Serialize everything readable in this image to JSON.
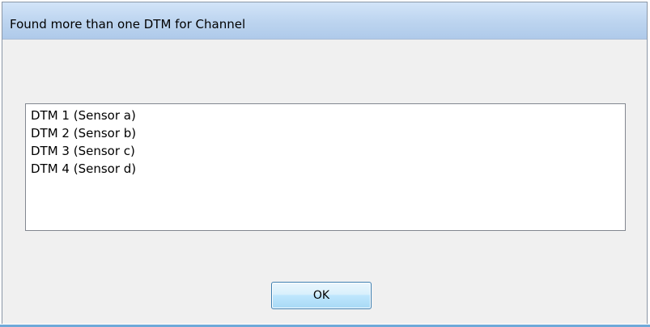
{
  "dialog": {
    "title": "Found more than one DTM for Channel"
  },
  "list": {
    "items": [
      {
        "label": "DTM 1 (Sensor a)"
      },
      {
        "label": "DTM 2 (Sensor b)"
      },
      {
        "label": "DTM 3 (Sensor c)"
      },
      {
        "label": "DTM 4 (Sensor d)"
      }
    ]
  },
  "buttons": {
    "ok_label": "OK"
  },
  "colors": {
    "titlebar": "#bcd4ef",
    "dialog_background": "#f0f0f0",
    "button_border": "#3c7fb1"
  }
}
